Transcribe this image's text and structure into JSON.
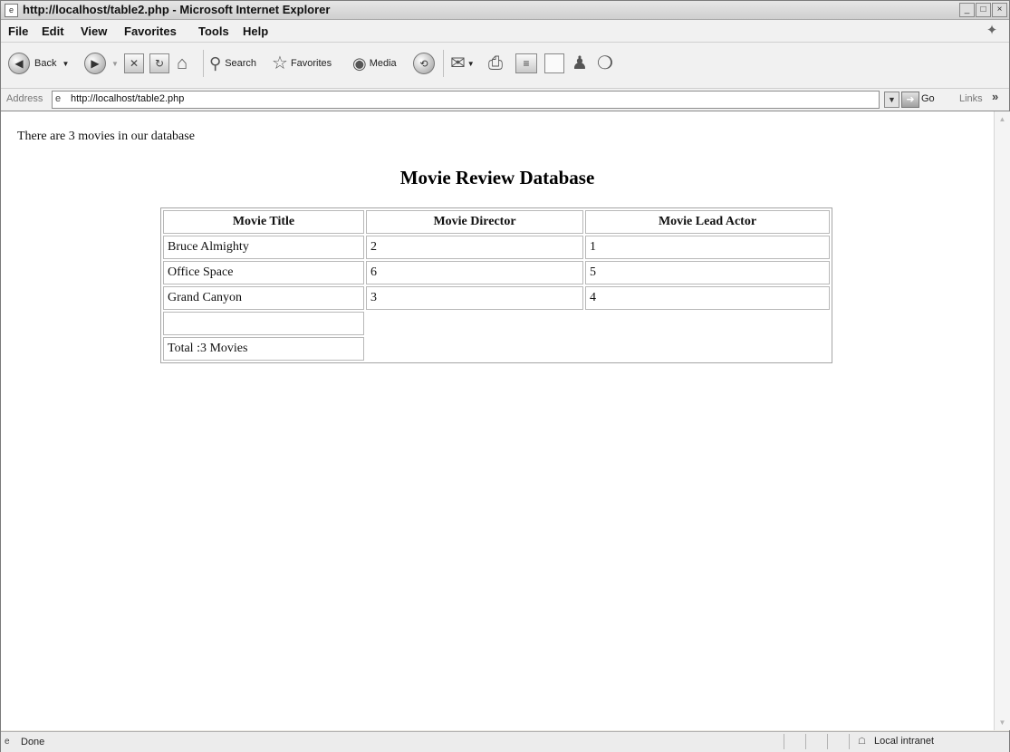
{
  "window": {
    "title": "http://localhost/table2.php - Microsoft Internet Explorer",
    "controls": [
      "_",
      "□",
      "×"
    ]
  },
  "menu": [
    {
      "label": "File"
    },
    {
      "label": "Edit"
    },
    {
      "label": "View"
    },
    {
      "label": "Favorites"
    },
    {
      "label": "Tools"
    },
    {
      "label": "Help"
    }
  ],
  "toolbar": {
    "back_label": "Back",
    "search_label": "Search",
    "favorites_label": "Favorites",
    "media_label": "Media"
  },
  "address": {
    "label": "Address",
    "url": "http://localhost/table2.php",
    "go_label": "Go",
    "links_label": "Links"
  },
  "page": {
    "intro": "There are 3 movies in our database",
    "heading": "Movie Review Database",
    "table": {
      "headers": [
        "Movie Title",
        "Movie Director",
        "Movie Lead Actor"
      ],
      "rows": [
        [
          "Bruce Almighty",
          "2",
          "1"
        ],
        [
          "Office Space",
          "6",
          "5"
        ],
        [
          "Grand Canyon",
          "3",
          "4"
        ]
      ],
      "total": "Total :3 Movies"
    }
  },
  "status": {
    "text": "Done",
    "zone": "Local intranet"
  }
}
